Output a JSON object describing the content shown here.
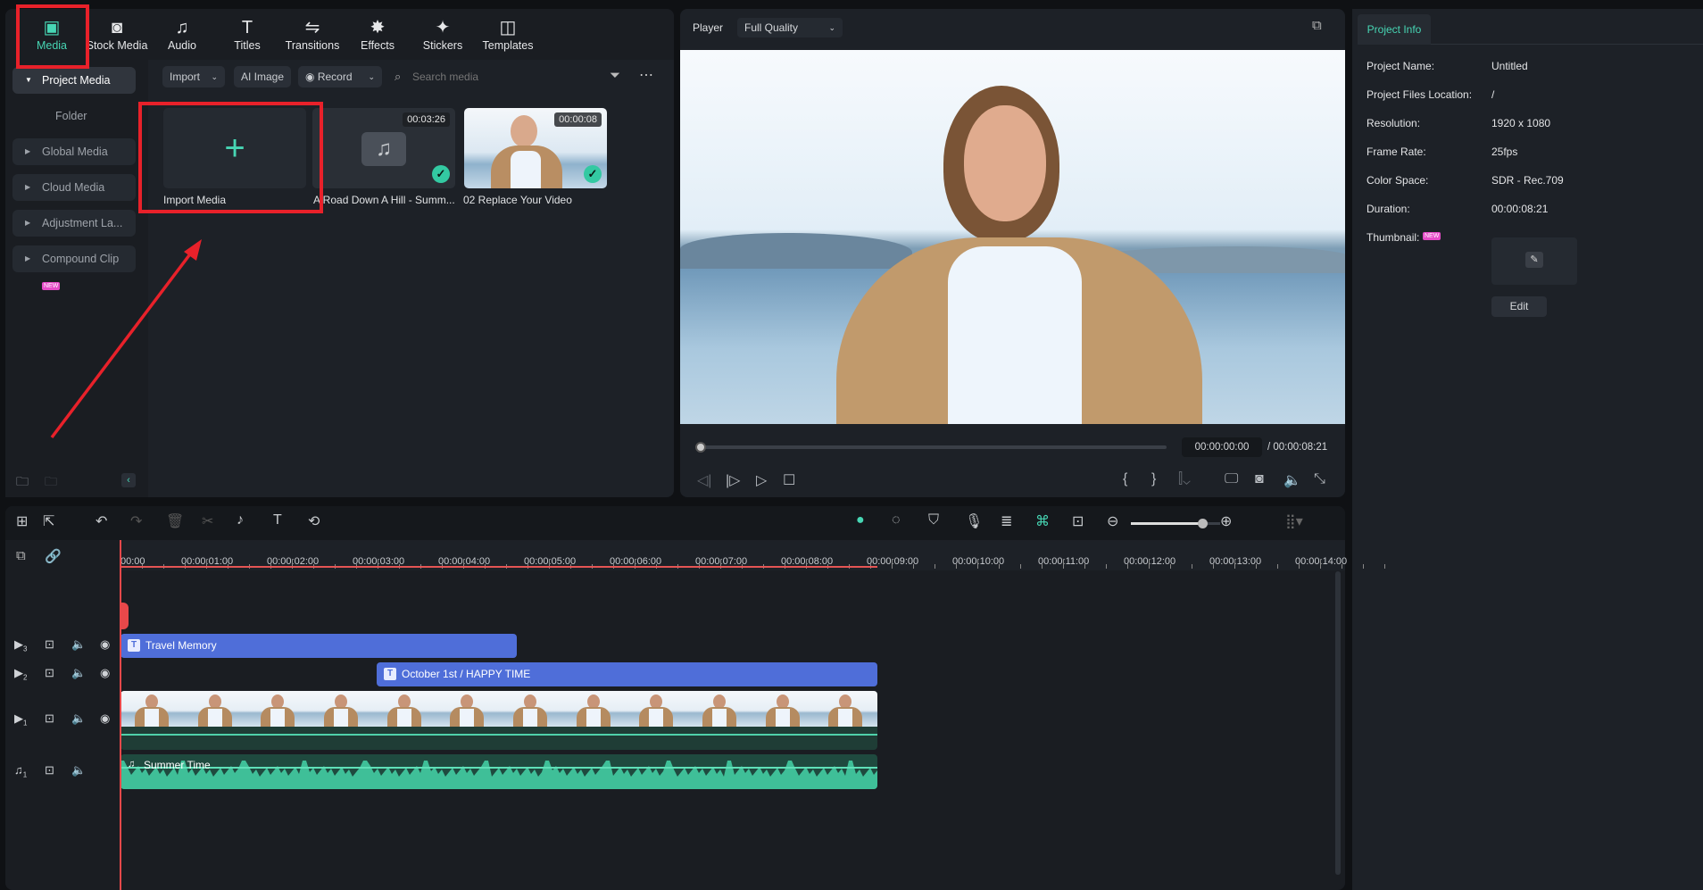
{
  "tabs": [
    {
      "label": "Media",
      "icon": "media-icon",
      "active": true
    },
    {
      "label": "Stock Media",
      "icon": "stock-media-icon"
    },
    {
      "label": "Audio",
      "icon": "music-note-icon"
    },
    {
      "label": "Titles",
      "icon": "titles-icon"
    },
    {
      "label": "Transitions",
      "icon": "transitions-icon"
    },
    {
      "label": "Effects",
      "icon": "effects-icon"
    },
    {
      "label": "Stickers",
      "icon": "stickers-icon"
    },
    {
      "label": "Templates",
      "icon": "templates-icon"
    }
  ],
  "sidebar": {
    "items": [
      {
        "label": "Project Media"
      },
      {
        "label": "Folder"
      },
      {
        "label": "Global Media"
      },
      {
        "label": "Cloud Media"
      },
      {
        "label": "Adjustment La..."
      },
      {
        "label": "Compound Clip",
        "badge": "NEW"
      }
    ]
  },
  "media_toolbar": {
    "import": "Import",
    "ai_image": "AI Image",
    "record": "Record",
    "search_placeholder": "Search media"
  },
  "media": [
    {
      "label": "Import Media"
    },
    {
      "label": "A Road Down A Hill - Summ...",
      "duration": "00:03:26"
    },
    {
      "label": "02 Replace Your Video",
      "duration": "00:00:08"
    }
  ],
  "player": {
    "label": "Player",
    "quality": "Full Quality",
    "current": "00:00:00:00",
    "total": "/ 00:00:08:21",
    "progress": 0
  },
  "project_info": {
    "tab": "Project Info",
    "rows": [
      {
        "label": "Project Name:",
        "value": "Untitled"
      },
      {
        "label": "Project Files Location:",
        "value": "/"
      },
      {
        "label": "Resolution:",
        "value": "1920 x 1080"
      },
      {
        "label": "Frame Rate:",
        "value": "25fps"
      },
      {
        "label": "Color Space:",
        "value": "SDR - Rec.709"
      },
      {
        "label": "Duration:",
        "value": "00:00:08:21"
      },
      {
        "label": "Thumbnail:",
        "badge": "NEW"
      }
    ],
    "edit": "Edit"
  },
  "timeline": {
    "ticks": [
      "00:00",
      "00:00:01:00",
      "00:00:02:00",
      "00:00:03:00",
      "00:00:04:00",
      "00:00:05:00",
      "00:00:06:00",
      "00:00:07:00",
      "00:00:08:00",
      "00:00:09:00",
      "00:00:10:00",
      "00:00:11:00",
      "00:00:12:00",
      "00:00:13:00",
      "00:00:14:00"
    ],
    "tracks": [
      {
        "num": "3"
      },
      {
        "num": "2"
      },
      {
        "num": "1"
      },
      {
        "num": "1"
      }
    ],
    "clips": {
      "title1": "Travel Memory",
      "title2": "October 1st / HAPPY TIME",
      "audio": "Summer Time"
    },
    "zoom_level": 0.8
  },
  "colors": {
    "accent": "#47d6b4",
    "title_clip": "#4f6ed9",
    "audio_clip": "#3fbf98",
    "highlight": "#e8212a"
  }
}
